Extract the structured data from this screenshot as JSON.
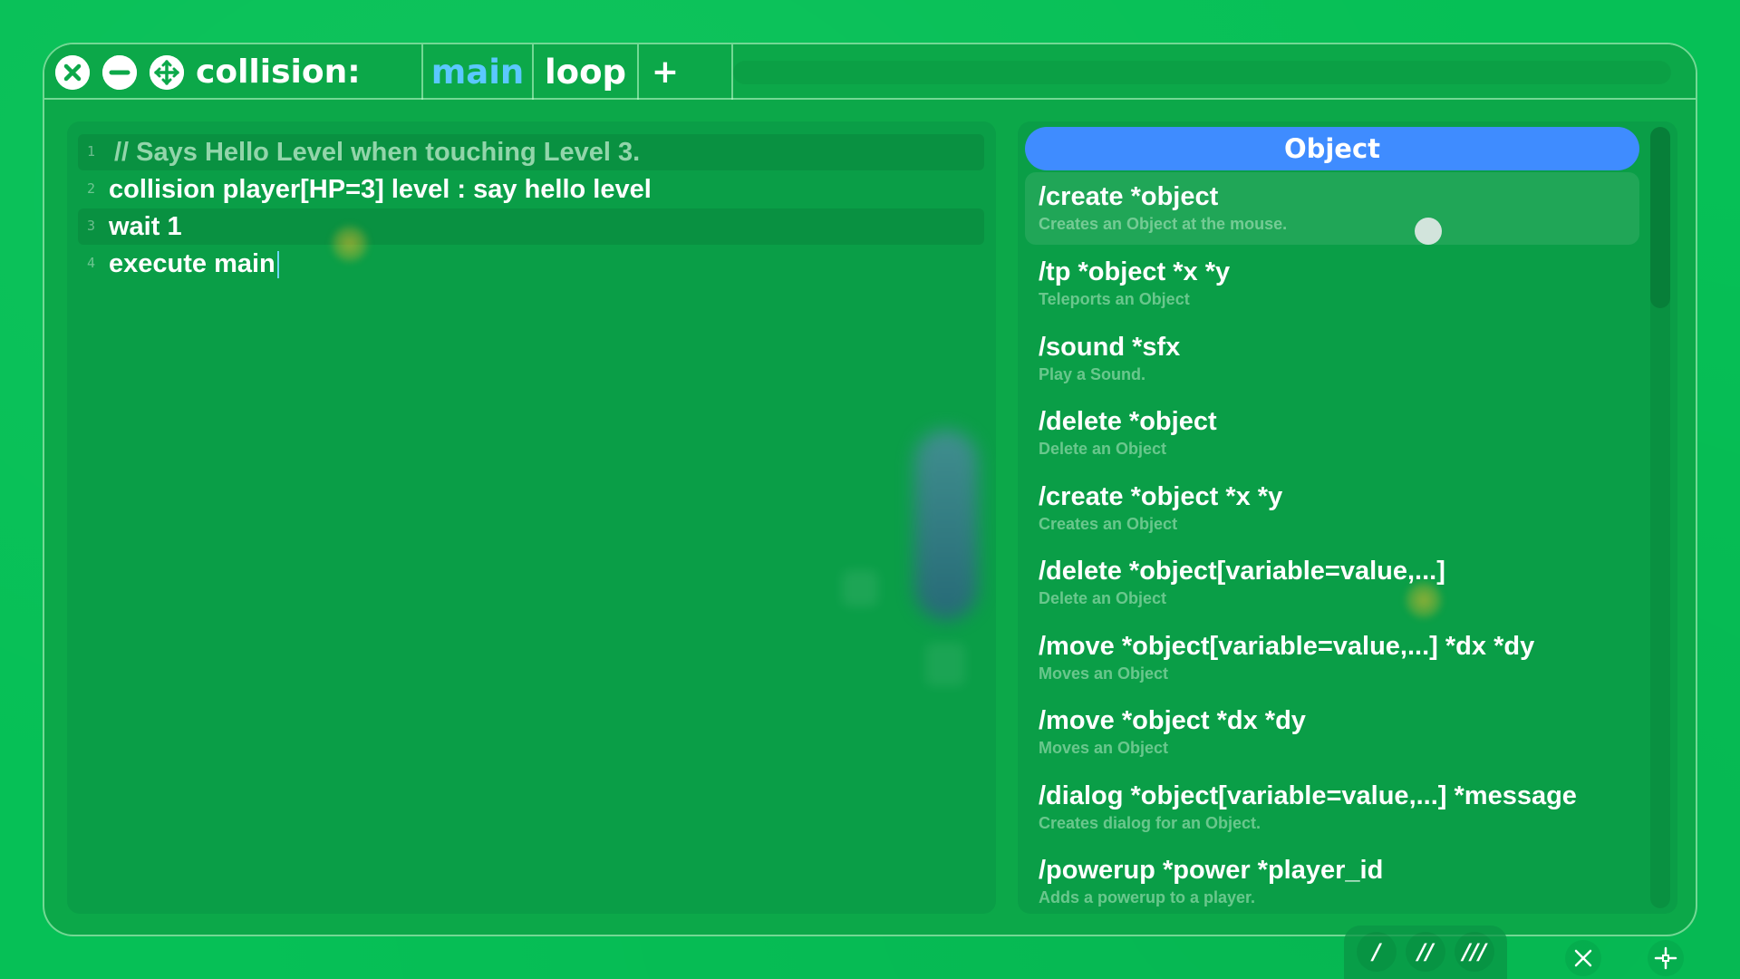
{
  "window": {
    "title": "collision:",
    "tabs": [
      {
        "label": "main",
        "active": true
      },
      {
        "label": "loop",
        "active": false
      }
    ],
    "add_tab_label": "+"
  },
  "editor": {
    "lines": [
      {
        "number": "1",
        "text": "// Says Hello Level when touching Level 3.",
        "type": "comment"
      },
      {
        "number": "2",
        "text": "collision player[HP=3] level : say hello level",
        "type": "code"
      },
      {
        "number": "3",
        "text": "wait 1",
        "type": "code"
      },
      {
        "number": "4",
        "text": "execute main",
        "type": "code"
      }
    ]
  },
  "palette": {
    "header": "Object",
    "commands": [
      {
        "name": "/create *object",
        "description": "Creates an Object at the mouse."
      },
      {
        "name": "/tp *object *x *y",
        "description": "Teleports an Object"
      },
      {
        "name": "/sound *sfx",
        "description": "Play a Sound."
      },
      {
        "name": "/delete *object",
        "description": "Delete an Object"
      },
      {
        "name": "/create *object *x *y",
        "description": "Creates an Object"
      },
      {
        "name": "/delete *object[variable=value,...]",
        "description": "Delete an Object"
      },
      {
        "name": "/move *object[variable=value,...] *dx *dy",
        "description": "Moves an Object"
      },
      {
        "name": "/move *object *dx *dy",
        "description": "Moves an Object"
      },
      {
        "name": "/dialog *object[variable=value,...] *message",
        "description": "Creates dialog for an Object."
      },
      {
        "name": "/powerup *power *player_id",
        "description": "Adds a powerup to a player."
      }
    ]
  },
  "toolbar": {
    "buttons": [
      "/",
      "//",
      "///"
    ]
  },
  "icons": {
    "close": "close-circle-icon",
    "minimize": "minus-circle-icon",
    "move": "move-arrows-icon",
    "bottom_close": "x-icon",
    "bottom_center": "crosshair-icon"
  },
  "colors": {
    "background": "#07c158",
    "window": "#0ca849",
    "accent_blue": "#3f8cff",
    "active_tab": "#5bc8ff"
  }
}
